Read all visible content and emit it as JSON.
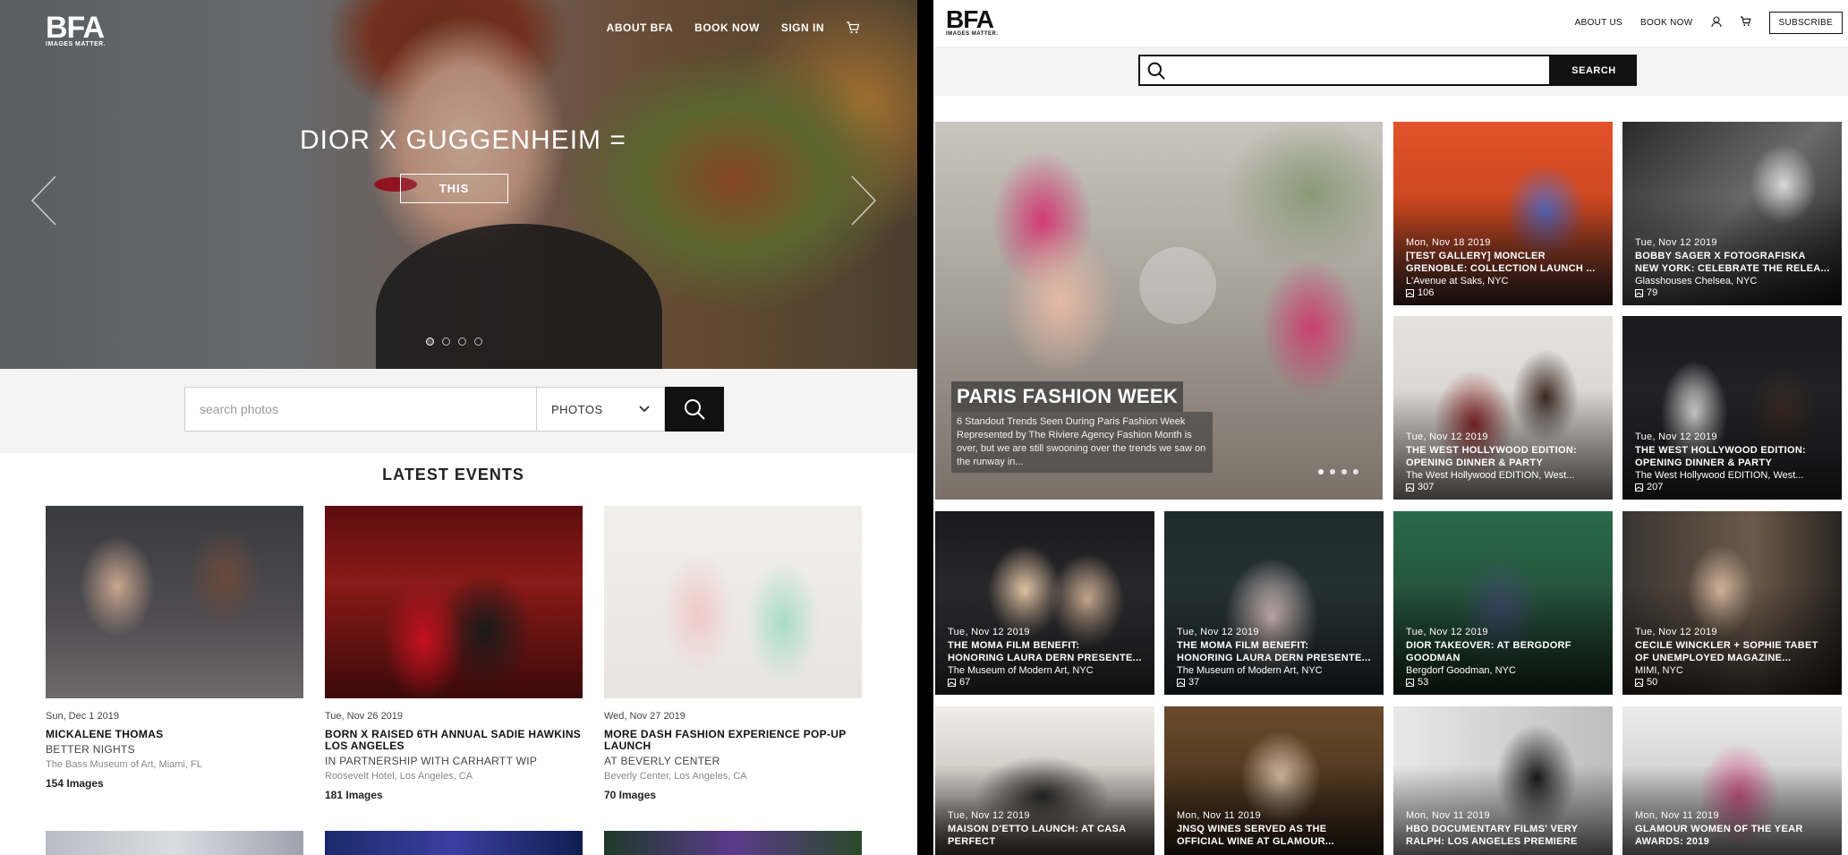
{
  "left": {
    "logo": {
      "main": "BFA",
      "tagline": "IMAGES MATTER."
    },
    "nav": [
      {
        "label": "ABOUT BFA"
      },
      {
        "label": "BOOK NOW"
      },
      {
        "label": "SIGN IN"
      }
    ],
    "hero": {
      "title": "DIOR X GUGGENHEIM =",
      "button_label": "THIS",
      "slide_count": 4,
      "active_slide": 1
    },
    "search": {
      "placeholder": "search photos",
      "type_selected": "PHOTOS"
    },
    "latest_heading": "LATEST EVENTS",
    "events": [
      {
        "date": "Sun, Dec 1 2019",
        "title": "MICKALENE THOMAS",
        "subtitle": "BETTER NIGHTS",
        "location": "The Bass Museum of Art, Miami, FL",
        "count": "154 Images"
      },
      {
        "date": "Tue, Nov 26 2019",
        "title": "BORN X RAISED 6TH ANNUAL SADIE HAWKINS LOS ANGELES",
        "subtitle": "IN PARTNERSHIP WITH CARHARTT WIP",
        "location": "Roosevelt Hotel, Los Angeles, CA",
        "count": "181 Images"
      },
      {
        "date": "Wed, Nov 27 2019",
        "title": "MORE DASH FASHION EXPERIENCE POP-UP LAUNCH",
        "subtitle": "AT BEVERLY CENTER",
        "location": "Beverly Center, Los Angeles, CA",
        "count": "70 Images"
      }
    ]
  },
  "right": {
    "logo": {
      "main": "BFA",
      "tagline": "IMAGES MATTER."
    },
    "nav": [
      {
        "label": "ABOUT US"
      },
      {
        "label": "BOOK NOW"
      }
    ],
    "subscribe_label": "SUBSCRIBE",
    "search_button": "SEARCH",
    "featured": {
      "title": "PARIS FASHION WEEK",
      "text": "6 Standout Trends Seen During Paris Fashion Week Represented by The Riviere Agency Fashion Month is over, but we are still swooning over the trends we saw on the runway in...",
      "slide_count": 4
    },
    "tiles": [
      {
        "date": "Mon, Nov 18 2019",
        "title": "[TEST GALLERY] MONCLER\nGRENOBLE: COLLECTION LAUNCH ...",
        "location": "L'Avenue at Saks, NYC",
        "count": "106"
      },
      {
        "date": "Tue, Nov 12 2019",
        "title": "BOBBY SAGER X FOTOGRAFISKA\nNEW YORK: CELEBRATE THE RELEA...",
        "location": "Glasshouses Chelsea, NYC",
        "count": "79"
      },
      {
        "date": "Tue, Nov 12 2019",
        "title": "THE WEST HOLLYWOOD EDITION:\nOPENING DINNER & PARTY",
        "location": "The West Hollywood EDITION, West...",
        "count": "307"
      },
      {
        "date": "Tue, Nov 12 2019",
        "title": "THE WEST HOLLYWOOD EDITION:\nOPENING DINNER & PARTY",
        "location": "The West Hollywood EDITION, West...",
        "count": "207"
      },
      {
        "date": "Tue, Nov 12 2019",
        "title": "THE MOMA FILM BENEFIT:\nHONORING LAURA DERN PRESENTE...",
        "location": "The Museum of Modern Art, NYC",
        "count": "67"
      },
      {
        "date": "Tue, Nov 12 2019",
        "title": "THE MOMA FILM BENEFIT:\nHONORING LAURA DERN PRESENTE...",
        "location": "The Museum of Modern Art, NYC",
        "count": "37"
      },
      {
        "date": "Tue, Nov 12 2019",
        "title": "DIOR TAKEOVER: AT BERGDORF\nGOODMAN",
        "location": "Bergdorf Goodman, NYC",
        "count": "53"
      },
      {
        "date": "Tue, Nov 12 2019",
        "title": "CECILE WINCKLER + SOPHIE TABET\nOF UNEMPLOYED MAGAZINE...",
        "location": "MIMI, NYC",
        "count": "50"
      },
      {
        "date": "Tue, Nov 12 2019",
        "title": "MAISON D'ETTO LAUNCH: AT CASA\nPERFECT",
        "location": "",
        "count": ""
      },
      {
        "date": "Mon, Nov 11 2019",
        "title": "JNSQ WINES SERVED AS THE\nOFFICIAL WINE AT GLAMOUR...",
        "location": "",
        "count": ""
      },
      {
        "date": "Mon, Nov 11 2019",
        "title": "HBO DOCUMENTARY FILMS' VERY\nRALPH: LOS ANGELES PREMIERE",
        "location": "",
        "count": ""
      },
      {
        "date": "Mon, Nov 11 2019",
        "title": "GLAMOUR WOMEN OF THE YEAR\nAWARDS: 2019",
        "location": "",
        "count": ""
      }
    ]
  }
}
